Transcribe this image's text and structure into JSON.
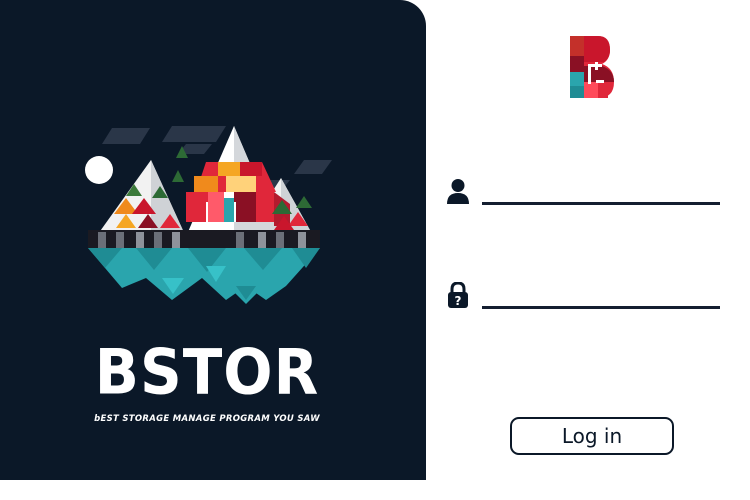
{
  "brand": {
    "name": "BSTOR",
    "tagline": "bEST STORAGE MANAGE PROGRAM YOU SAW",
    "logo_letter": "B"
  },
  "colors": {
    "panel_bg": "#0b1828",
    "teal": "#2aa5ad",
    "red": "#e0273a",
    "orange": "#f08a1c",
    "dark_red": "#8a1024",
    "field_line": "#141e30"
  },
  "icons": {
    "username": "user-icon",
    "password": "padlock-icon",
    "illustration": "mountain-illustration",
    "logo": "b-logo-icon"
  },
  "form": {
    "username": {
      "value": "",
      "placeholder": ""
    },
    "password": {
      "value": "",
      "placeholder": ""
    },
    "login_label": "Log in"
  }
}
